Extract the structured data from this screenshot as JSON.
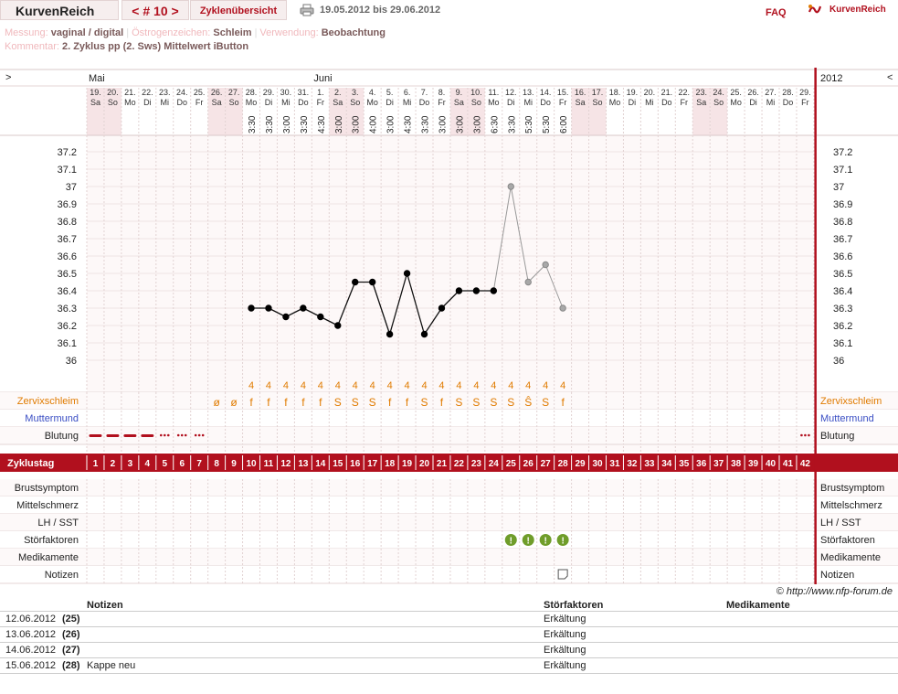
{
  "topbar": {
    "title": "KurvenReich",
    "cycle": "< # 10 >",
    "overview": "Zyklenübersicht",
    "range": "19.05.2012 bis 29.06.2012",
    "faq": "FAQ",
    "brand": "KurvenReich"
  },
  "meta": {
    "measure_label": "Messung:",
    "measure_value": "vaginal / digital",
    "estrogen_label": "Östrogenzeichen:",
    "estrogen_value": "Schleim",
    "usage_label": "Verwendung:",
    "usage_value": "Beobachtung",
    "comment_label": "Kommentar:",
    "comment_value": "2. Zyklus pp (2. Sws) Mittelwert iButton"
  },
  "nav": {
    "left": ">",
    "right": "<",
    "year": "2012"
  },
  "months": [
    {
      "label": "Mai",
      "day": 1
    },
    {
      "label": "Juni",
      "day": 14
    }
  ],
  "days": [
    {
      "d": "19.",
      "w": "Sa",
      "time": "",
      "we": true
    },
    {
      "d": "20.",
      "w": "So",
      "time": "",
      "we": true
    },
    {
      "d": "21.",
      "w": "Mo",
      "time": "",
      "we": false
    },
    {
      "d": "22.",
      "w": "Di",
      "time": "",
      "we": false
    },
    {
      "d": "23.",
      "w": "Mi",
      "time": "",
      "we": false
    },
    {
      "d": "24.",
      "w": "Do",
      "time": "",
      "we": false
    },
    {
      "d": "25.",
      "w": "Fr",
      "time": "",
      "we": false
    },
    {
      "d": "26.",
      "w": "Sa",
      "time": "",
      "we": true
    },
    {
      "d": "27.",
      "w": "So",
      "time": "",
      "we": true
    },
    {
      "d": "28.",
      "w": "Mo",
      "time": "3:30",
      "we": false
    },
    {
      "d": "29.",
      "w": "Di",
      "time": "3:30",
      "we": false
    },
    {
      "d": "30.",
      "w": "Mi",
      "time": "3:00",
      "we": false
    },
    {
      "d": "31.",
      "w": "Do",
      "time": "3:30",
      "we": false
    },
    {
      "d": "1.",
      "w": "Fr",
      "time": "4:30",
      "we": false
    },
    {
      "d": "2.",
      "w": "Sa",
      "time": "3:00",
      "we": true
    },
    {
      "d": "3.",
      "w": "So",
      "time": "3:00",
      "we": true
    },
    {
      "d": "4.",
      "w": "Mo",
      "time": "4:00",
      "we": false
    },
    {
      "d": "5.",
      "w": "Di",
      "time": "3:00",
      "we": false
    },
    {
      "d": "6.",
      "w": "Mi",
      "time": "4:30",
      "we": false
    },
    {
      "d": "7.",
      "w": "Do",
      "time": "3:30",
      "we": false
    },
    {
      "d": "8.",
      "w": "Fr",
      "time": "3:00",
      "we": false
    },
    {
      "d": "9.",
      "w": "Sa",
      "time": "3:00",
      "we": true
    },
    {
      "d": "10.",
      "w": "So",
      "time": "3:00",
      "we": true
    },
    {
      "d": "11.",
      "w": "Mo",
      "time": "6:30",
      "we": false
    },
    {
      "d": "12.",
      "w": "Di",
      "time": "3:30",
      "we": false
    },
    {
      "d": "13.",
      "w": "Mi",
      "time": "5:30",
      "we": false
    },
    {
      "d": "14.",
      "w": "Do",
      "time": "5:30",
      "we": false
    },
    {
      "d": "15.",
      "w": "Fr",
      "time": "6:00",
      "we": false
    },
    {
      "d": "16.",
      "w": "Sa",
      "time": "",
      "we": true
    },
    {
      "d": "17.",
      "w": "So",
      "time": "",
      "we": true
    },
    {
      "d": "18.",
      "w": "Mo",
      "time": "",
      "we": false
    },
    {
      "d": "19.",
      "w": "Di",
      "time": "",
      "we": false
    },
    {
      "d": "20.",
      "w": "Mi",
      "time": "",
      "we": false
    },
    {
      "d": "21.",
      "w": "Do",
      "time": "",
      "we": false
    },
    {
      "d": "22.",
      "w": "Fr",
      "time": "",
      "we": false
    },
    {
      "d": "23.",
      "w": "Sa",
      "time": "",
      "we": true
    },
    {
      "d": "24.",
      "w": "So",
      "time": "",
      "we": true
    },
    {
      "d": "25.",
      "w": "Mo",
      "time": "",
      "we": false
    },
    {
      "d": "26.",
      "w": "Di",
      "time": "",
      "we": false
    },
    {
      "d": "27.",
      "w": "Mi",
      "time": "",
      "we": false
    },
    {
      "d": "28.",
      "w": "Do",
      "time": "",
      "we": false
    },
    {
      "d": "29.",
      "w": "Fr",
      "time": "",
      "we": false
    }
  ],
  "chart_data": {
    "type": "line",
    "title": "",
    "ylim": [
      35.9,
      37.3
    ],
    "yticks": [
      "37.2",
      "37.1",
      "37",
      "36.9",
      "36.8",
      "36.7",
      "36.6",
      "36.5",
      "36.4",
      "36.3",
      "36.2",
      "36.1",
      "36"
    ],
    "series": [
      {
        "values": [
          null,
          null,
          null,
          null,
          null,
          null,
          null,
          null,
          null,
          36.3,
          36.3,
          36.25,
          36.3,
          36.25,
          36.2,
          36.45,
          36.45,
          36.15,
          36.5,
          36.15,
          36.3,
          36.4,
          36.4,
          36.4,
          37.0,
          36.45,
          36.55,
          36.3,
          null,
          null,
          null,
          null,
          null,
          null,
          null,
          null,
          null,
          null,
          null,
          null,
          null,
          null
        ],
        "disturbed_from_cycle_day": 25
      }
    ]
  },
  "mucus_top": [
    "",
    "",
    "",
    "",
    "",
    "",
    "",
    "",
    "",
    "4",
    "4",
    "4",
    "4",
    "4",
    "4",
    "4",
    "4",
    "4",
    "4",
    "4",
    "4",
    "4",
    "4",
    "4",
    "4",
    "4",
    "4",
    "4",
    "",
    "",
    "",
    "",
    "",
    "",
    "",
    "",
    "",
    "",
    "",
    "",
    "",
    ""
  ],
  "mucus": [
    "",
    "",
    "",
    "",
    "",
    "",
    "",
    "ø",
    "ø",
    "f",
    "f",
    "f",
    "f",
    "f",
    "S",
    "S",
    "S",
    "f",
    "f",
    "S",
    "f",
    "S",
    "S",
    "S",
    "S",
    "Ŝ",
    "S",
    "f",
    "",
    "",
    "",
    "",
    "",
    "",
    "",
    "",
    "",
    "",
    "",
    "",
    "",
    ""
  ],
  "bleeding": [
    "strong",
    "strong",
    "strong",
    "strong",
    "light",
    "light",
    "light",
    "",
    "",
    "",
    "",
    "",
    "",
    "",
    "",
    "",
    "",
    "",
    "",
    "",
    "",
    "",
    "",
    "",
    "",
    "",
    "",
    "",
    "",
    "",
    "",
    "",
    "",
    "",
    "",
    "",
    "",
    "",
    "",
    "",
    "",
    "light"
  ],
  "rows": {
    "mucus": "Zervixschleim",
    "cervix": "Muttermund",
    "bleeding": "Blutung",
    "cycleday": "Zyklustag",
    "breast": "Brustsymptom",
    "midpain": "Mittelschmerz",
    "lh": "LH / SST",
    "disturb": "Störfaktoren",
    "meds": "Medikamente",
    "notes": "Notizen"
  },
  "disturb_days": [
    25,
    26,
    27,
    28
  ],
  "notes_day": 28,
  "copyright": "© http://www.nfp-forum.de",
  "notes_table": {
    "headers": {
      "notes": "Notizen",
      "disturb": "Störfaktoren",
      "meds": "Medikamente"
    },
    "rows": [
      {
        "date": "12.06.2012",
        "day": "(25)",
        "note": "",
        "disturb": "Erkältung",
        "meds": ""
      },
      {
        "date": "13.06.2012",
        "day": "(26)",
        "note": "",
        "disturb": "Erkältung",
        "meds": ""
      },
      {
        "date": "14.06.2012",
        "day": "(27)",
        "note": "",
        "disturb": "Erkältung",
        "meds": ""
      },
      {
        "date": "15.06.2012",
        "day": "(28)",
        "note": "Kappe neu",
        "disturb": "Erkältung",
        "meds": ""
      }
    ]
  },
  "colors": {
    "accent": "#b1101e",
    "mucus": "#e07b00",
    "cervix": "#3b4fc4",
    "weekend": "#f6e4e6",
    "disturb": "#6f9d2a"
  }
}
